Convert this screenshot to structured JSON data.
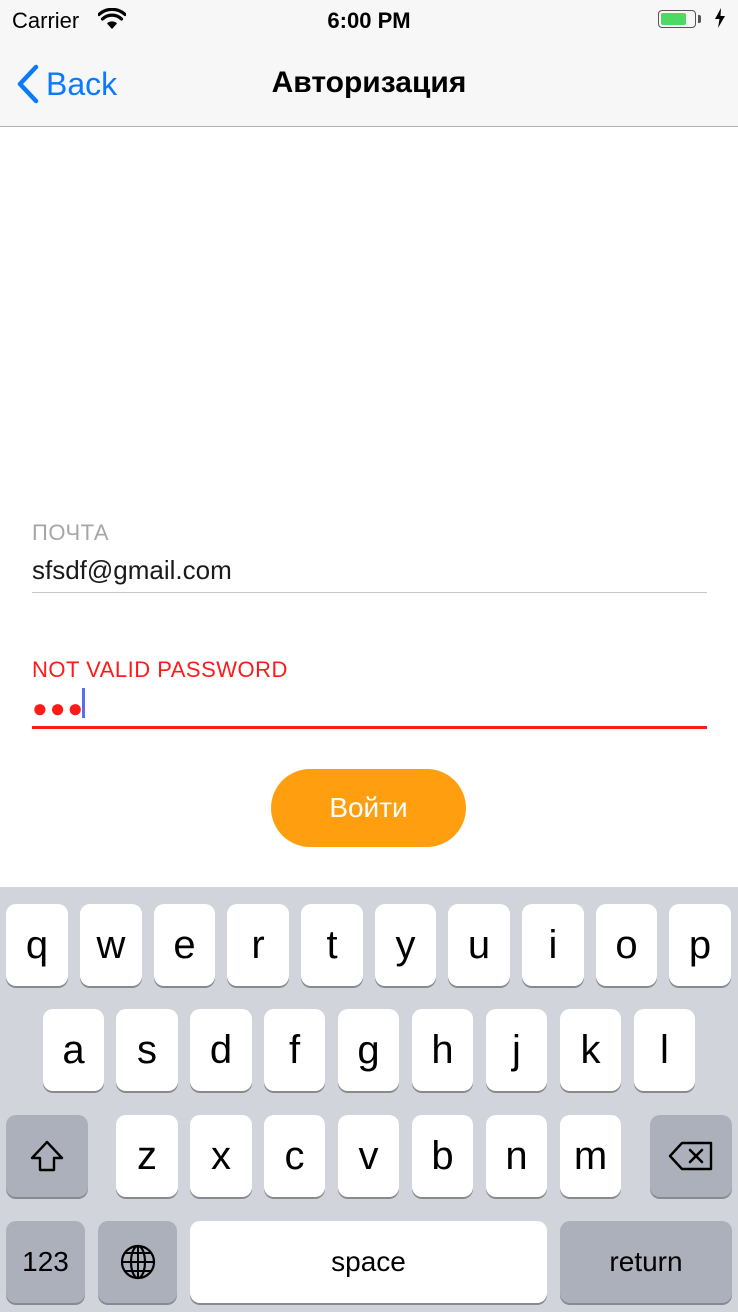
{
  "status_bar": {
    "carrier": "Carrier",
    "time": "6:00 PM",
    "battery_level": 0.8
  },
  "nav": {
    "back_label": "Back",
    "title": "Авторизация"
  },
  "form": {
    "email_label": "ПОЧТА",
    "email_value": "sfsdf@gmail.com",
    "password_error_label": "NOT VALID PASSWORD",
    "password_masked": "●●●",
    "submit_label": "Войти"
  },
  "keyboard": {
    "row1": [
      "q",
      "w",
      "e",
      "r",
      "t",
      "y",
      "u",
      "i",
      "o",
      "p"
    ],
    "row2": [
      "a",
      "s",
      "d",
      "f",
      "g",
      "h",
      "j",
      "k",
      "l"
    ],
    "row3": [
      "z",
      "x",
      "c",
      "v",
      "b",
      "n",
      "m"
    ],
    "numbers_label": "123",
    "space_label": "space",
    "return_label": "return"
  },
  "colors": {
    "accent": "#0a7aff",
    "button": "#ff9e0f",
    "error": "#ff1a1a"
  }
}
